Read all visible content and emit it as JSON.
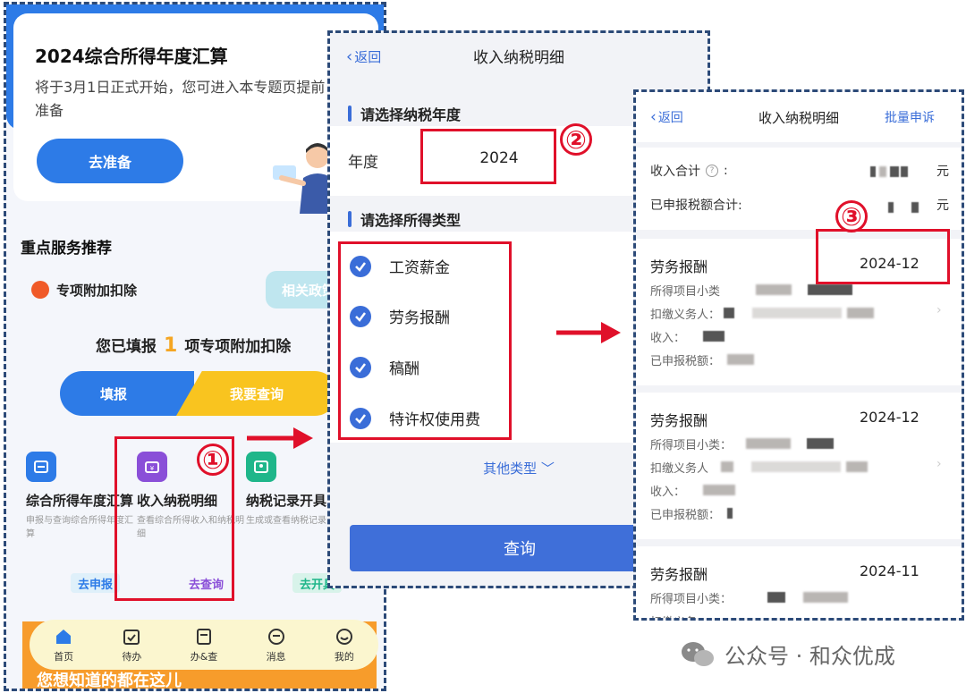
{
  "panel1": {
    "title": "2024综合所得年度汇算",
    "subtitle": "将于3月1日正式开始，您可进入本专题页提前准备",
    "prepare_button": "去准备",
    "section_title": "重点服务推荐",
    "special_deduction_label": "专项附加扣除",
    "policy_tag": "相关政策",
    "filled_prefix": "您已填报",
    "filled_count": "1",
    "filled_suffix": "项专项附加扣除",
    "fill_button": "填报",
    "query_button": "我要查询",
    "tools": [
      {
        "title": "综合所得年度汇算",
        "desc": "申报与查询综合所得年度汇算",
        "tag": "去申报",
        "color": "#2d7be7"
      },
      {
        "title": "收入纳税明细",
        "desc": "查看综合所得收入和纳税明细",
        "tag": "去查询",
        "color": "#8a4fd8"
      },
      {
        "title": "纳税记录开具",
        "desc": "生成或查看纳税记录",
        "tag": "去开具",
        "color": "#1fb68a"
      }
    ],
    "nav": [
      {
        "label": "首页",
        "icon": "home-icon"
      },
      {
        "label": "待办",
        "icon": "calendar-icon"
      },
      {
        "label": "办&查",
        "icon": "document-icon"
      },
      {
        "label": "消息",
        "icon": "chat-icon"
      },
      {
        "label": "我的",
        "icon": "smile-icon"
      }
    ],
    "banner_text": "您想知道的都在这儿"
  },
  "panel2": {
    "back": "返回",
    "title": "收入纳税明细",
    "year_section": "请选择纳税年度",
    "year_label": "年度",
    "year_value": "2024",
    "type_section": "请选择所得类型",
    "types": [
      "工资薪金",
      "劳务报酬",
      "稿酬",
      "特许权使用费"
    ],
    "more_types": "其他类型",
    "query_button": "查询"
  },
  "panel3": {
    "back": "返回",
    "title": "收入纳税明细",
    "appeal": "批量申诉",
    "income_total_label": "收入合计",
    "declared_total_label": "已申报税额合计:",
    "currency": "元",
    "records": [
      {
        "type": "劳务报酬",
        "month": "2024-12",
        "fields": [
          "所得项目小类",
          "扣缴义务人：",
          "收入：",
          "已申报税额："
        ]
      },
      {
        "type": "劳务报酬",
        "month": "2024-12",
        "fields": [
          "所得项目小类：",
          "扣缴义务人",
          "收入：",
          "已申报税额："
        ]
      },
      {
        "type": "劳务报酬",
        "month": "2024-11",
        "fields": [
          "所得项目小类：",
          "扣缴义务"
        ]
      }
    ]
  },
  "annotations": {
    "step1": "①",
    "step2": "②",
    "step3": "③"
  },
  "watermark": {
    "text": "公众号 · 和众优成"
  },
  "colors": {
    "accent_blue": "#2d7be7",
    "annotation_red": "#e0102a",
    "frame_navy": "#2c4a78"
  }
}
